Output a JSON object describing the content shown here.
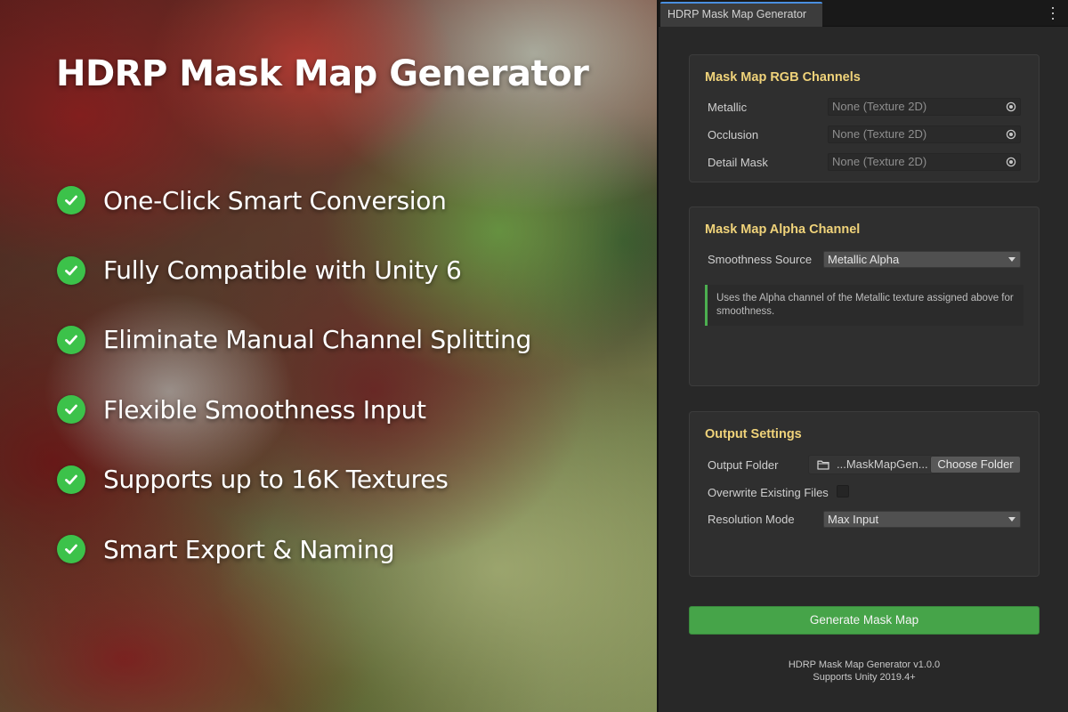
{
  "promo": {
    "title": "HDRP Mask Map Generator",
    "features": [
      "One-Click Smart Conversion",
      "Fully Compatible with Unity 6",
      "Eliminate Manual Channel Splitting",
      "Flexible Smoothness Input",
      "Supports up to 16K Textures",
      "Smart Export & Naming"
    ],
    "check_icon": "check-circle-icon",
    "check_color": "#3cc24a"
  },
  "window": {
    "tab_title": "HDRP Mask Map Generator",
    "menu_icon": "kebab-menu-icon",
    "accent": "#f0d37a"
  },
  "rgb_section": {
    "title": "Mask Map RGB Channels",
    "fields": [
      {
        "label": "Metallic",
        "value": "None (Texture 2D)"
      },
      {
        "label": "Occlusion",
        "value": "None (Texture 2D)"
      },
      {
        "label": "Detail Mask",
        "value": "None (Texture 2D)"
      }
    ],
    "picker_icon": "object-picker-icon"
  },
  "alpha_section": {
    "title": "Mask Map Alpha Channel",
    "smoothness_label": "Smoothness Source",
    "smoothness_value": "Metallic Alpha",
    "help_text": "Uses the Alpha channel of the Metallic texture assigned above for smoothness."
  },
  "output_section": {
    "title": "Output Settings",
    "folder_label": "Output Folder",
    "folder_value": "...MaskMapGen...",
    "folder_icon": "folder-icon",
    "choose_label": "Choose Folder",
    "overwrite_label": "Overwrite Existing Files",
    "overwrite_checked": false,
    "resolution_label": "Resolution Mode",
    "resolution_value": "Max Input"
  },
  "generate_label": "Generate Mask Map",
  "generate_color": "#46a449",
  "footer": {
    "version": "HDRP Mask Map Generator v1.0.0",
    "support": "Supports Unity 2019.4+"
  }
}
